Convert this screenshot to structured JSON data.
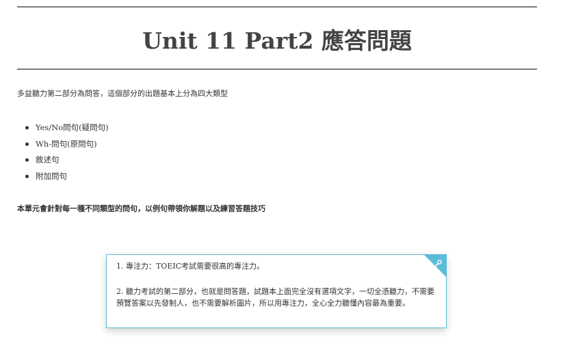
{
  "page": {
    "title": "Unit 11 Part2 應答問題",
    "intro": "多益聽力第二部分為問答，這個部分的出題基本上分為四大類型",
    "question_types": [
      "Yes/No問句(疑問句)",
      "Wh-問句(原問句)",
      "敘述句",
      "附加問句"
    ],
    "summary": "本單元會針對每一種不同類型的問句，以例句帶領你解題以及練習答題技巧"
  },
  "note": {
    "icon": "pin-icon",
    "accent_color": "#5bbcd9",
    "items": [
      "1. 專注力：TOEIC考試需要很高的專注力。",
      "2. 聽力考試的第二部分，也就是問答題，試題本上面完全沒有選項文字，一切全憑聽力，不需要預覽答案以先發制人，也不需要解析圖片，所以用專注力，全心全力聽懂內容最為重要。"
    ]
  }
}
